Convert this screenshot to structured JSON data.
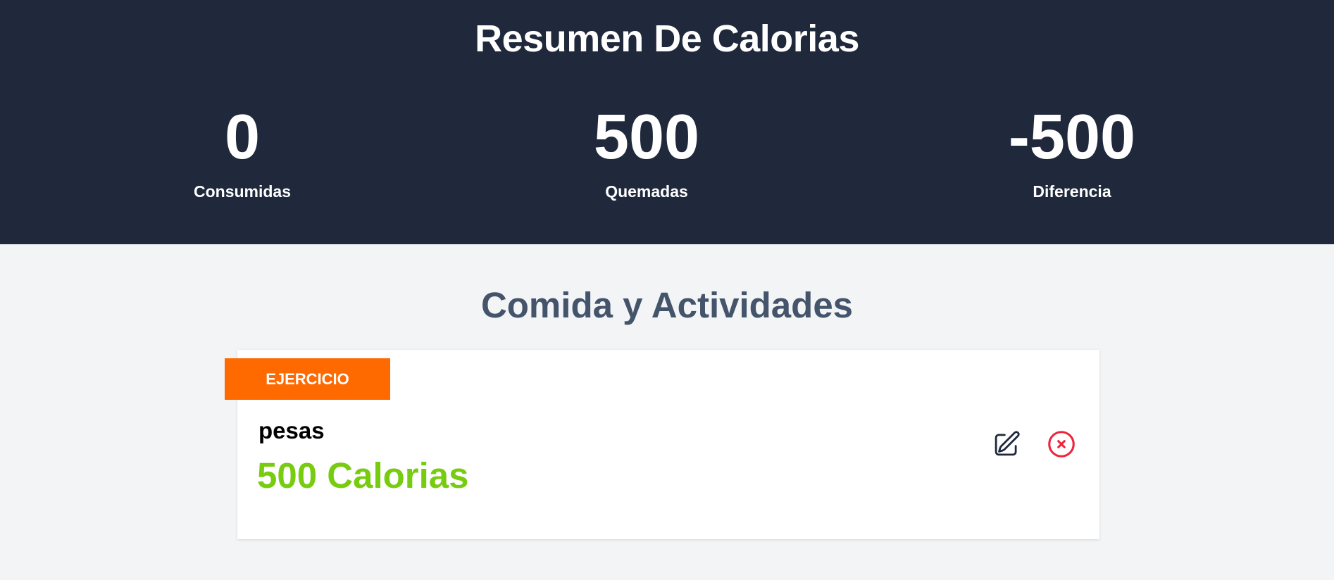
{
  "header": {
    "title": "Resumen De Calorias",
    "stats": [
      {
        "value": "0",
        "label": "Consumidas"
      },
      {
        "value": "500",
        "label": "Quemadas"
      },
      {
        "value": "-500",
        "label": "Diferencia"
      }
    ]
  },
  "activities": {
    "title": "Comida y Actividades",
    "items": [
      {
        "category": "EJERCICIO",
        "name": "pesas",
        "calories": "500 Calorias",
        "edit_icon": "pencil-square-icon",
        "delete_icon": "x-circle-icon"
      }
    ]
  },
  "colors": {
    "header_bg": "#1f293b",
    "page_bg": "#f3f4f6",
    "badge_exercise": "#ff6a00",
    "calories_text": "#77cc10",
    "delete_icon": "#ef233c",
    "section_title": "#44546b"
  }
}
